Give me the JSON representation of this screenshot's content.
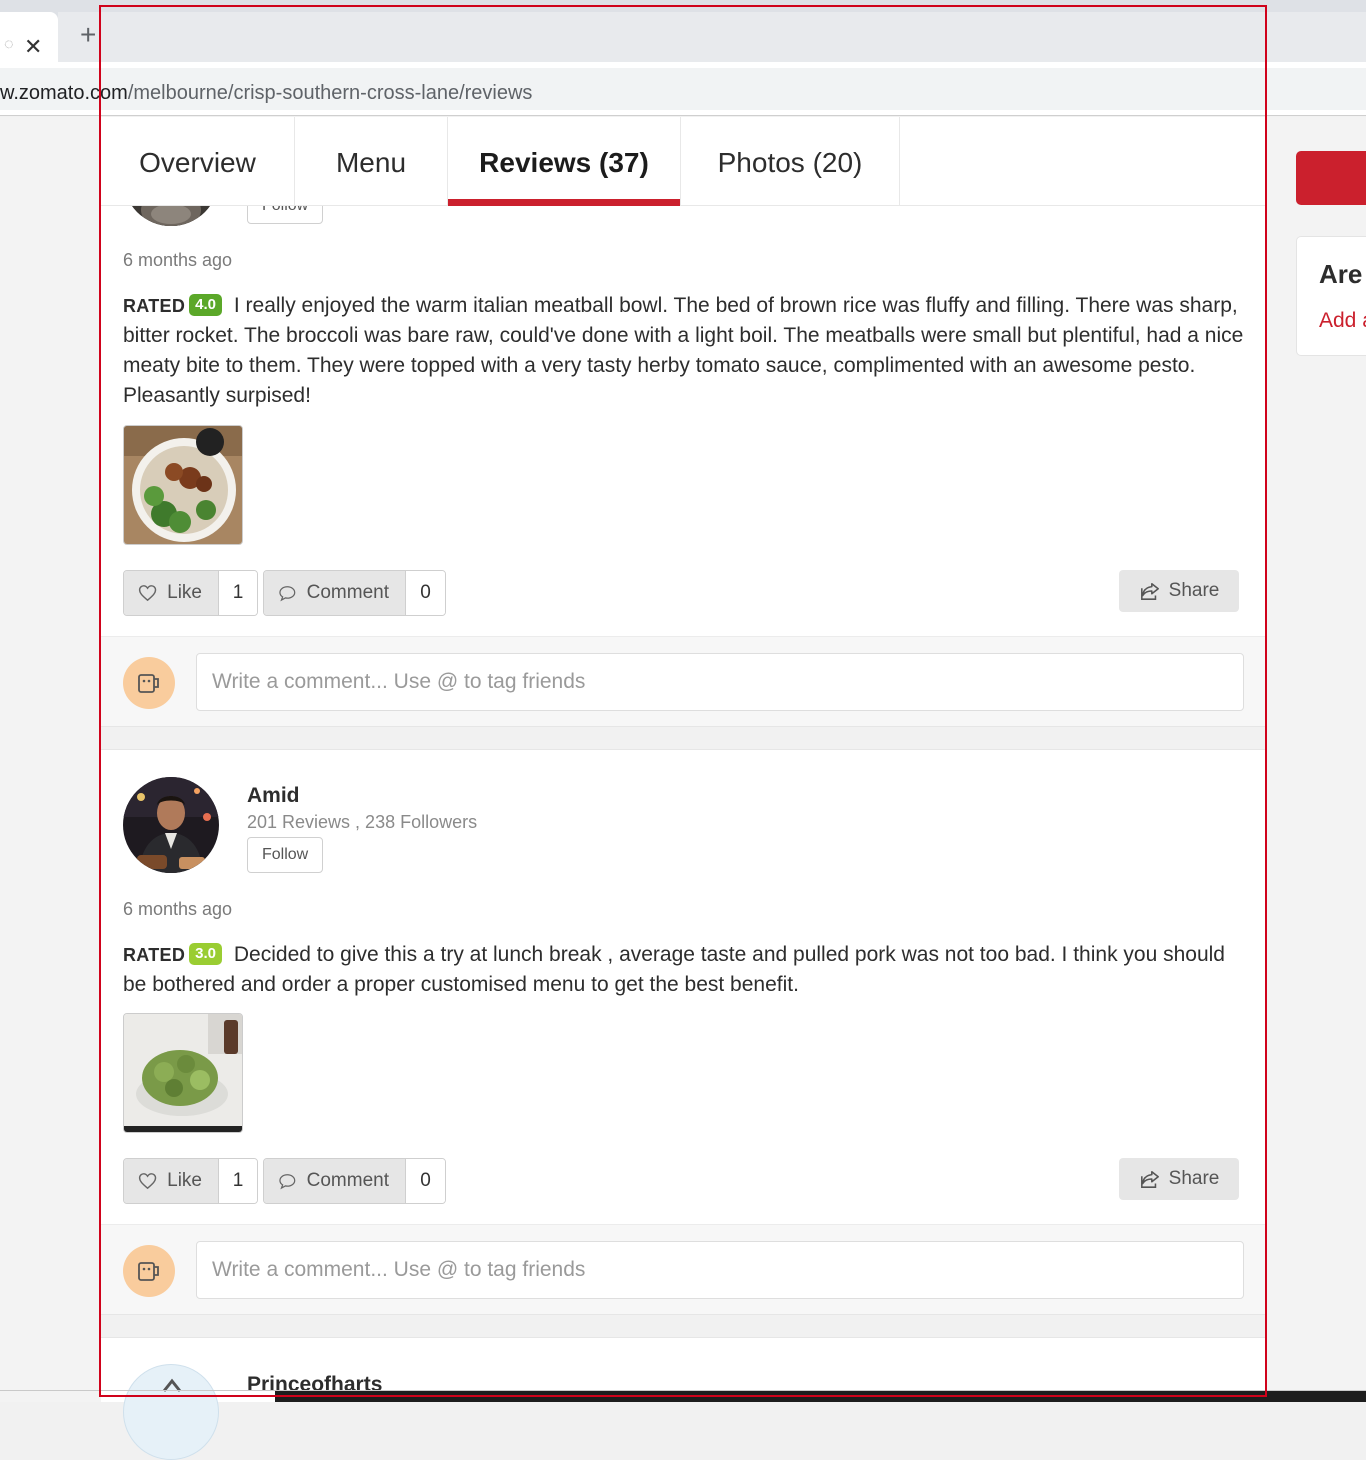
{
  "browser": {
    "close_glyph": "✕",
    "new_tab_glyph": "+",
    "url_host": "w.zomato.com",
    "url_path": "/melbourne/crisp-southern-cross-lane/reviews"
  },
  "nav": {
    "tabs": [
      {
        "label": "Overview"
      },
      {
        "label": "Menu"
      },
      {
        "label": "Reviews (37)"
      },
      {
        "label": "Photos (20)"
      }
    ],
    "active_tab": "Reviews (37)"
  },
  "reviews": [
    {
      "follow_label": "Follow",
      "time": "6 months ago",
      "rated_label": "RATED",
      "rating": "4.0",
      "rating_color": "#5ba829",
      "text": "I really enjoyed the warm italian meatball bowl. The bed of brown rice was fluffy and filling. There was sharp, bitter rocket. The broccoli was bare raw, could've done with a light boil. The meatballs were small but plentiful, had a nice meaty bite to them. They were topped with a very tasty herby tomato sauce, complimented with an awesome pesto. Pleasantly surpised!",
      "like_label": "Like",
      "like_count": "1",
      "comment_label": "Comment",
      "comment_count": "0",
      "share_label": "Share",
      "comment_placeholder": "Write a comment... Use @ to tag friends"
    },
    {
      "user_name": "Amid",
      "user_stats": "201 Reviews , 238 Followers",
      "follow_label": "Follow",
      "time": "6 months ago",
      "rated_label": "RATED",
      "rating": "3.0",
      "rating_color": "#9acd32",
      "text": "Decided to give this a try at lunch break , average taste and pulled pork was not too bad. I think you should be bothered and order a proper customised menu to get the best benefit.",
      "like_label": "Like",
      "like_count": "1",
      "comment_label": "Comment",
      "comment_count": "0",
      "share_label": "Share",
      "comment_placeholder": "Write a comment... Use @ to tag friends"
    },
    {
      "user_name": "Princeofharts"
    }
  ],
  "sidebar": {
    "card_title": "Are",
    "card_link": "Add a"
  },
  "colors": {
    "brand_red": "#cb202d",
    "badge_green": "#5ba829",
    "badge_lime": "#9acd32"
  }
}
